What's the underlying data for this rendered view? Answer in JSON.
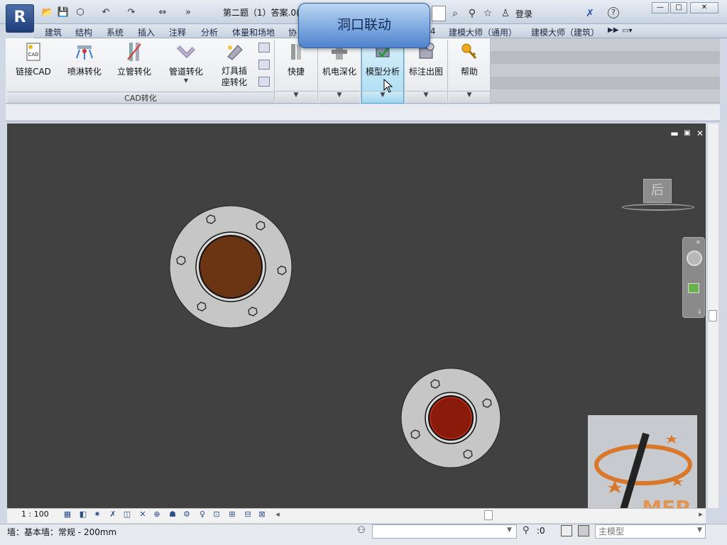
{
  "title": {
    "app_letter": "R",
    "document": "第二题（1）答案.0(",
    "login": "登录",
    "window_controls": [
      "—",
      "□",
      "✕"
    ]
  },
  "tabs": [
    "建筑",
    "结构",
    "系统",
    "插入",
    "注释",
    "分析",
    "体量和场地",
    "协",
    "4",
    "建模大师（通用）",
    "建模大师（建筑）"
  ],
  "ribbon": {
    "cad_group": {
      "buttons": [
        "链接CAD",
        "喷淋转化",
        "立管转化",
        "管道转化",
        "灯具插座转化"
      ],
      "group_label": "CAD转化"
    },
    "panels": [
      "快捷",
      "机电深化",
      "模型分析",
      "标注出图",
      "帮助"
    ],
    "dropdown_glyph": "▼",
    "highlighted_panel": "模型分析"
  },
  "tooltip": {
    "text": "洞口联动"
  },
  "canvas": {
    "background": "#414141",
    "viewcube_face": "后",
    "view_controls": [
      "▬",
      "▣",
      "✕"
    ]
  },
  "view_control_bar": {
    "scale": "1 : 100"
  },
  "status_bar": {
    "selection_text": "墙：基本墙：常规 - 200mm",
    "filter_count": ":0",
    "model": "主模型"
  },
  "watermark": {
    "text": "MEP"
  },
  "colors": {
    "pipe_fill": "#6b3413",
    "pipe_fill_red": "#8a1a0a",
    "flange": "#c6c6c6",
    "accent": "#5ea7cf"
  }
}
